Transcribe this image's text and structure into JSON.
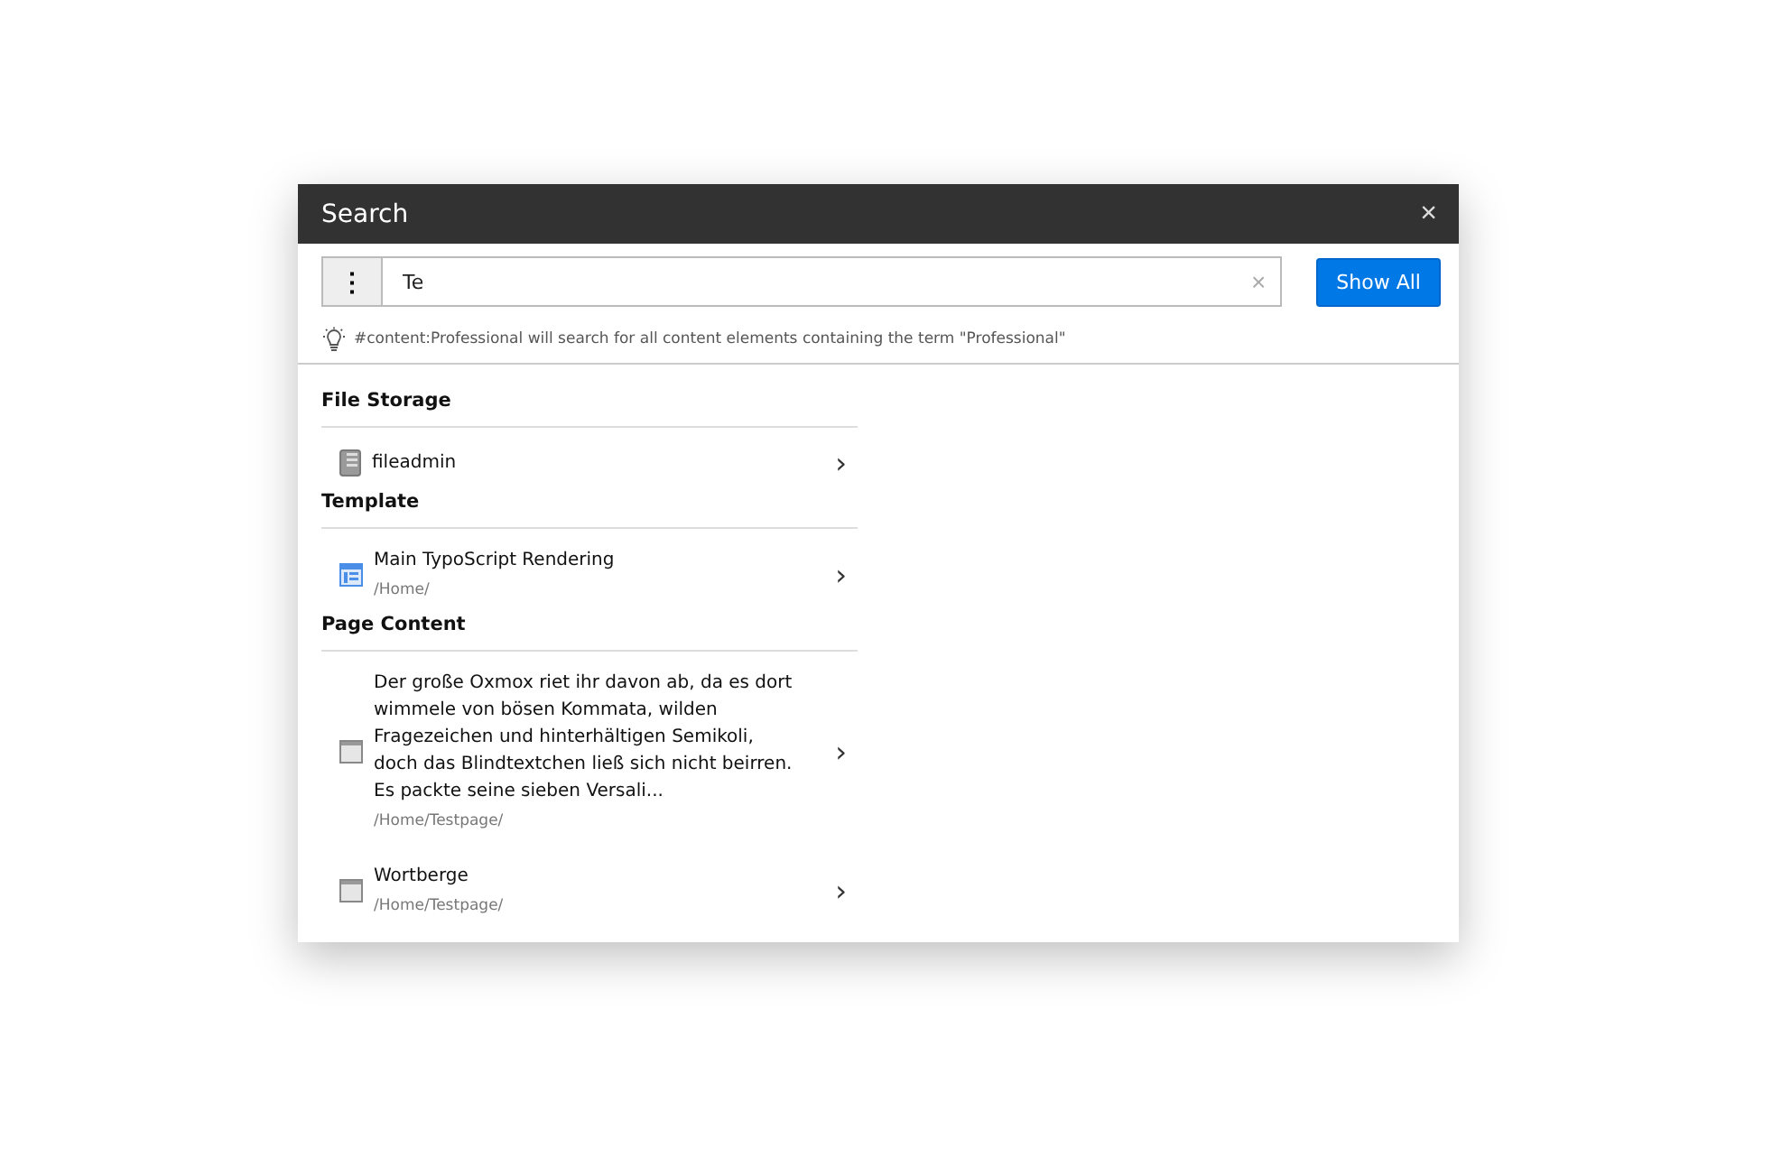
{
  "modal": {
    "title": "Search",
    "close": "×"
  },
  "search": {
    "menu": "⋮",
    "value": "Te",
    "clear": "×",
    "button": "Show All"
  },
  "hint": "#content:Professional will search for all content elements containing the term \"Professional\"",
  "groups": [
    {
      "title": "File Storage",
      "items": [
        {
          "kind": "storage",
          "title": "fileadmin",
          "chevron": "›"
        }
      ]
    },
    {
      "title": "Template",
      "items": [
        {
          "kind": "template",
          "title": "Main TypoScript Rendering",
          "path": "/Home/",
          "chevron": "›"
        }
      ]
    },
    {
      "title": "Page Content",
      "items": [
        {
          "kind": "content",
          "title": "Der große Oxmox riet ihr davon ab, da es dort wimmele von bösen Kommata, wilden Fragezeichen und hinterhältigen Semikoli, doch das Blindtextchen ließ sich nicht beirren. Es packte seine sieben Versali...",
          "path": "/Home/Testpage/",
          "chevron": "›"
        },
        {
          "kind": "content",
          "title": "Wortberge",
          "path": "/Home/Testpage/",
          "chevron": "›"
        }
      ]
    }
  ]
}
